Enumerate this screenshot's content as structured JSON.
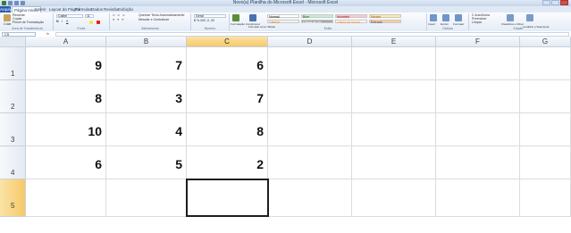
{
  "window": {
    "title": "Novo(a) Planilha do Microsoft Excel - Microsoft Excel"
  },
  "ribbon_tabs": [
    "Arquivo",
    "Página Inicial",
    "Inserir",
    "Layout da Página",
    "Fórmulas",
    "Dados",
    "Revisão",
    "Exibição"
  ],
  "ribbon": {
    "clipboard": {
      "paste": "Colar",
      "cut": "Recortar",
      "copy": "Copiar",
      "format_painter": "Pincel de Formatação",
      "label": "Área de Transferência"
    },
    "font": {
      "name": "Calibri",
      "size": "11",
      "label": "Fonte"
    },
    "alignment": {
      "wrap": "Quebrar Texto Automaticamente",
      "merge": "Mesclar e Centralizar",
      "label": "Alinhamento"
    },
    "number": {
      "format": "Geral",
      "label": "Número"
    },
    "styles": {
      "conditional": "Formatação Condicional",
      "as_table": "Formatar como Tabela",
      "cells": [
        {
          "text": "Normal",
          "bg": "#ffffff",
          "color": "#000000"
        },
        {
          "text": "Bom",
          "bg": "#c6efce",
          "color": "#006100"
        },
        {
          "text": "Incorreto",
          "bg": "#ffc7ce",
          "color": "#9c0006"
        },
        {
          "text": "Neutra",
          "bg": "#ffeb9c",
          "color": "#9c5700"
        },
        {
          "text": "Cálculo",
          "bg": "#f2f2f2",
          "color": "#fa7d00"
        },
        {
          "text": "Célula de Ve...",
          "bg": "#a5a5a5",
          "color": "#ffffff"
        },
        {
          "text": "Célula de Vincul...",
          "bg": "#ffffff",
          "color": "#fa7d00"
        },
        {
          "text": "Entrada",
          "bg": "#ffcc99",
          "color": "#3f3f76"
        }
      ],
      "label": "Estilo"
    },
    "cells": {
      "insert": "Inserir",
      "delete": "Excluir",
      "format": "Formatar",
      "label": "Células"
    },
    "editing": {
      "autosum": "AutoSoma",
      "fill": "Preencher",
      "clear": "Limpar",
      "sort": "Classificar e Filtrar",
      "find": "Localizar e Selecionar",
      "label": "Edição"
    }
  },
  "formula_bar": {
    "name_box": "C5",
    "fx": "fx",
    "value": ""
  },
  "columns": [
    "A",
    "B",
    "C",
    "D",
    "E",
    "F",
    "G"
  ],
  "rows": [
    "1",
    "2",
    "3",
    "4",
    "5"
  ],
  "cells": [
    [
      "9",
      "7",
      "6"
    ],
    [
      "8",
      "3",
      "7"
    ],
    [
      "10",
      "4",
      "8"
    ],
    [
      "6",
      "5",
      "2"
    ],
    [
      "",
      "",
      ""
    ]
  ],
  "selected": {
    "col": "C",
    "row": "5"
  }
}
